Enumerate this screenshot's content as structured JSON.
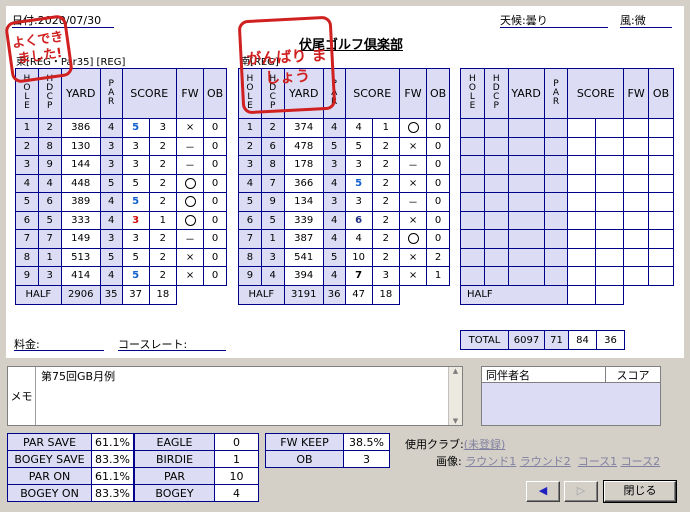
{
  "header": {
    "date_label": "日付:",
    "date": "2020/07/30",
    "weather_label": "天候:",
    "weather": "曇り",
    "wind_label": "風:",
    "wind": "微",
    "club_name": "伏尾ゴルフ倶楽部"
  },
  "stamps": {
    "left": "よくでき ました!",
    "center": "がんばり ましょう"
  },
  "course_labels": {
    "out": "東[REG・Par35] [REG]",
    "in": "南[REG]"
  },
  "columns": {
    "hole": "HOLE",
    "hdcp": "HDCP",
    "yard": "YARD",
    "par": "PAR",
    "score": "SCORE",
    "fw": "FW",
    "ob": "OB"
  },
  "out_holes": [
    {
      "hole": "1",
      "hdcp": "2",
      "yard": "386",
      "par": "4",
      "score": "5",
      "putt": "3",
      "fw": "×",
      "ob": "0",
      "style": "blue"
    },
    {
      "hole": "2",
      "hdcp": "8",
      "yard": "130",
      "par": "3",
      "score": "3",
      "putt": "2",
      "fw": "－",
      "ob": "0",
      "style": ""
    },
    {
      "hole": "3",
      "hdcp": "9",
      "yard": "144",
      "par": "3",
      "score": "3",
      "putt": "2",
      "fw": "－",
      "ob": "0",
      "style": ""
    },
    {
      "hole": "4",
      "hdcp": "4",
      "yard": "448",
      "par": "5",
      "score": "5",
      "putt": "2",
      "fw": "○",
      "ob": "0",
      "style": ""
    },
    {
      "hole": "5",
      "hdcp": "6",
      "yard": "389",
      "par": "4",
      "score": "5",
      "putt": "2",
      "fw": "○",
      "ob": "0",
      "style": "blue"
    },
    {
      "hole": "6",
      "hdcp": "5",
      "yard": "333",
      "par": "4",
      "score": "3",
      "putt": "1",
      "fw": "○",
      "ob": "0",
      "style": "red"
    },
    {
      "hole": "7",
      "hdcp": "7",
      "yard": "149",
      "par": "3",
      "score": "3",
      "putt": "2",
      "fw": "－",
      "ob": "0",
      "style": ""
    },
    {
      "hole": "8",
      "hdcp": "1",
      "yard": "513",
      "par": "5",
      "score": "5",
      "putt": "2",
      "fw": "×",
      "ob": "0",
      "style": ""
    },
    {
      "hole": "9",
      "hdcp": "3",
      "yard": "414",
      "par": "4",
      "score": "5",
      "putt": "2",
      "fw": "×",
      "ob": "0",
      "style": "blue"
    }
  ],
  "out_half": {
    "label": "HALF",
    "yard": "2906",
    "par": "35",
    "score": "37",
    "putt": "18"
  },
  "in_holes": [
    {
      "hole": "1",
      "hdcp": "2",
      "yard": "374",
      "par": "4",
      "score": "4",
      "putt": "1",
      "fw": "○",
      "ob": "0",
      "style": ""
    },
    {
      "hole": "2",
      "hdcp": "6",
      "yard": "478",
      "par": "5",
      "score": "5",
      "putt": "2",
      "fw": "×",
      "ob": "0",
      "style": ""
    },
    {
      "hole": "3",
      "hdcp": "8",
      "yard": "178",
      "par": "3",
      "score": "3",
      "putt": "2",
      "fw": "－",
      "ob": "0",
      "style": ""
    },
    {
      "hole": "4",
      "hdcp": "7",
      "yard": "366",
      "par": "4",
      "score": "5",
      "putt": "2",
      "fw": "×",
      "ob": "0",
      "style": "blue"
    },
    {
      "hole": "5",
      "hdcp": "9",
      "yard": "134",
      "par": "3",
      "score": "3",
      "putt": "2",
      "fw": "－",
      "ob": "0",
      "style": ""
    },
    {
      "hole": "6",
      "hdcp": "5",
      "yard": "339",
      "par": "4",
      "score": "6",
      "putt": "2",
      "fw": "×",
      "ob": "0",
      "style": "navy"
    },
    {
      "hole": "7",
      "hdcp": "1",
      "yard": "387",
      "par": "4",
      "score": "4",
      "putt": "2",
      "fw": "○",
      "ob": "0",
      "style": ""
    },
    {
      "hole": "8",
      "hdcp": "3",
      "yard": "541",
      "par": "5",
      "score": "10",
      "putt": "2",
      "fw": "×",
      "ob": "2",
      "style": ""
    },
    {
      "hole": "9",
      "hdcp": "4",
      "yard": "394",
      "par": "4",
      "score": "7",
      "putt": "3",
      "fw": "×",
      "ob": "1",
      "style": "black"
    }
  ],
  "in_half": {
    "label": "HALF",
    "yard": "3191",
    "par": "36",
    "score": "47",
    "putt": "18"
  },
  "third_half": {
    "label": "HALF"
  },
  "total": {
    "label": "TOTAL",
    "yard": "6097",
    "par": "71",
    "score": "84",
    "putt": "36"
  },
  "fee_label": "料金:",
  "course_rate_label": "コースレート:",
  "memo": {
    "label": "メモ",
    "text": "第75回GB月例"
  },
  "companions": {
    "name_header": "同伴者名",
    "score_header": "スコア"
  },
  "stats_left": [
    {
      "k": "PAR SAVE",
      "v": "61.1%"
    },
    {
      "k": "BOGEY SAVE",
      "v": "83.3%"
    },
    {
      "k": "PAR ON",
      "v": "61.1%"
    },
    {
      "k": "BOGEY ON",
      "v": "83.3%"
    }
  ],
  "stats_mid": [
    {
      "k": "EAGLE",
      "v": "0"
    },
    {
      "k": "BIRDIE",
      "v": "1"
    },
    {
      "k": "PAR",
      "v": "10"
    },
    {
      "k": "BOGEY",
      "v": "4"
    }
  ],
  "stats_right": [
    {
      "k": "FW KEEP",
      "v": "38.5%"
    },
    {
      "k": "OB",
      "v": "3"
    }
  ],
  "clubs": {
    "label": "使用クラブ:",
    "value": "(未登録)"
  },
  "images": {
    "label": "画像:",
    "round1": "ラウンド1",
    "round2": "ラウンド2",
    "course1": "コース1",
    "course2": "コース2"
  },
  "buttons": {
    "close": "閉じる"
  },
  "colors": {
    "header_cell": "#dcdcf4",
    "grid": "#00008b",
    "stamp": "#d02020",
    "birdie": "#d01010",
    "bogey": "#1060d0"
  }
}
